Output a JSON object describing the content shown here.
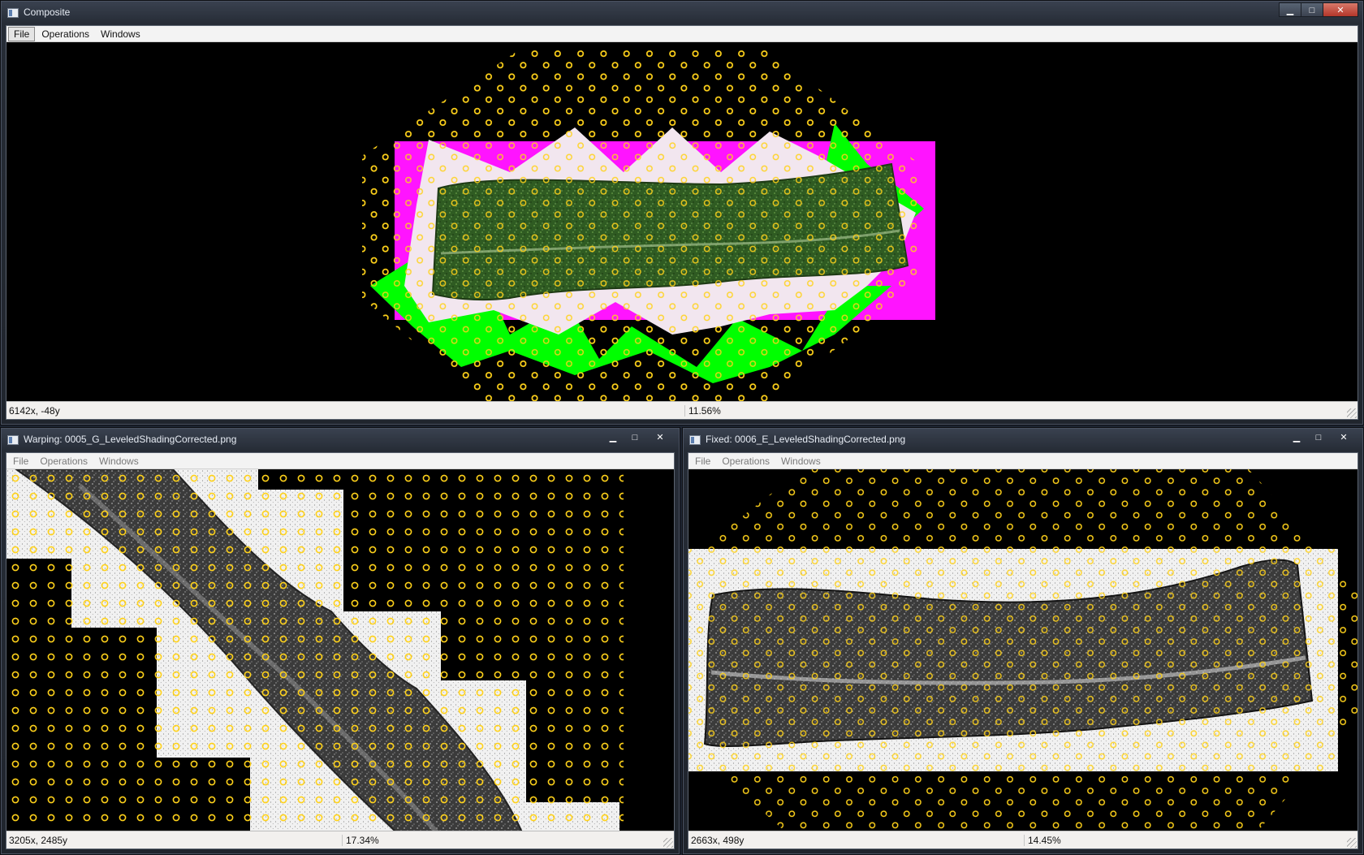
{
  "composite": {
    "title": "Composite",
    "menu": [
      "File",
      "Operations",
      "Windows"
    ],
    "coords": "6142x, -48y",
    "zoom": "11.56%"
  },
  "warping": {
    "title": "Warping: 0005_G_LeveledShadingCorrected.png",
    "menu": [
      "File",
      "Operations",
      "Windows"
    ],
    "coords": "3205x, 2485y",
    "zoom": "17.34%"
  },
  "fixed": {
    "title": "Fixed: 0006_E_LeveledShadingCorrected.png",
    "menu": [
      "File",
      "Operations",
      "Windows"
    ],
    "coords": "2663x, 498y",
    "zoom": "14.45%"
  },
  "window_controls": {
    "minimize": "▁",
    "maximize": "□",
    "close": "✕"
  },
  "colors": {
    "warping_overlay": "#00ff00",
    "fixed_overlay": "#ff00ff",
    "control_points": "#ffd21a",
    "tissue": "#2f3a2f"
  },
  "icons": [
    "app-icon",
    "minimize-icon",
    "maximize-icon",
    "close-icon",
    "size-grip-icon"
  ]
}
